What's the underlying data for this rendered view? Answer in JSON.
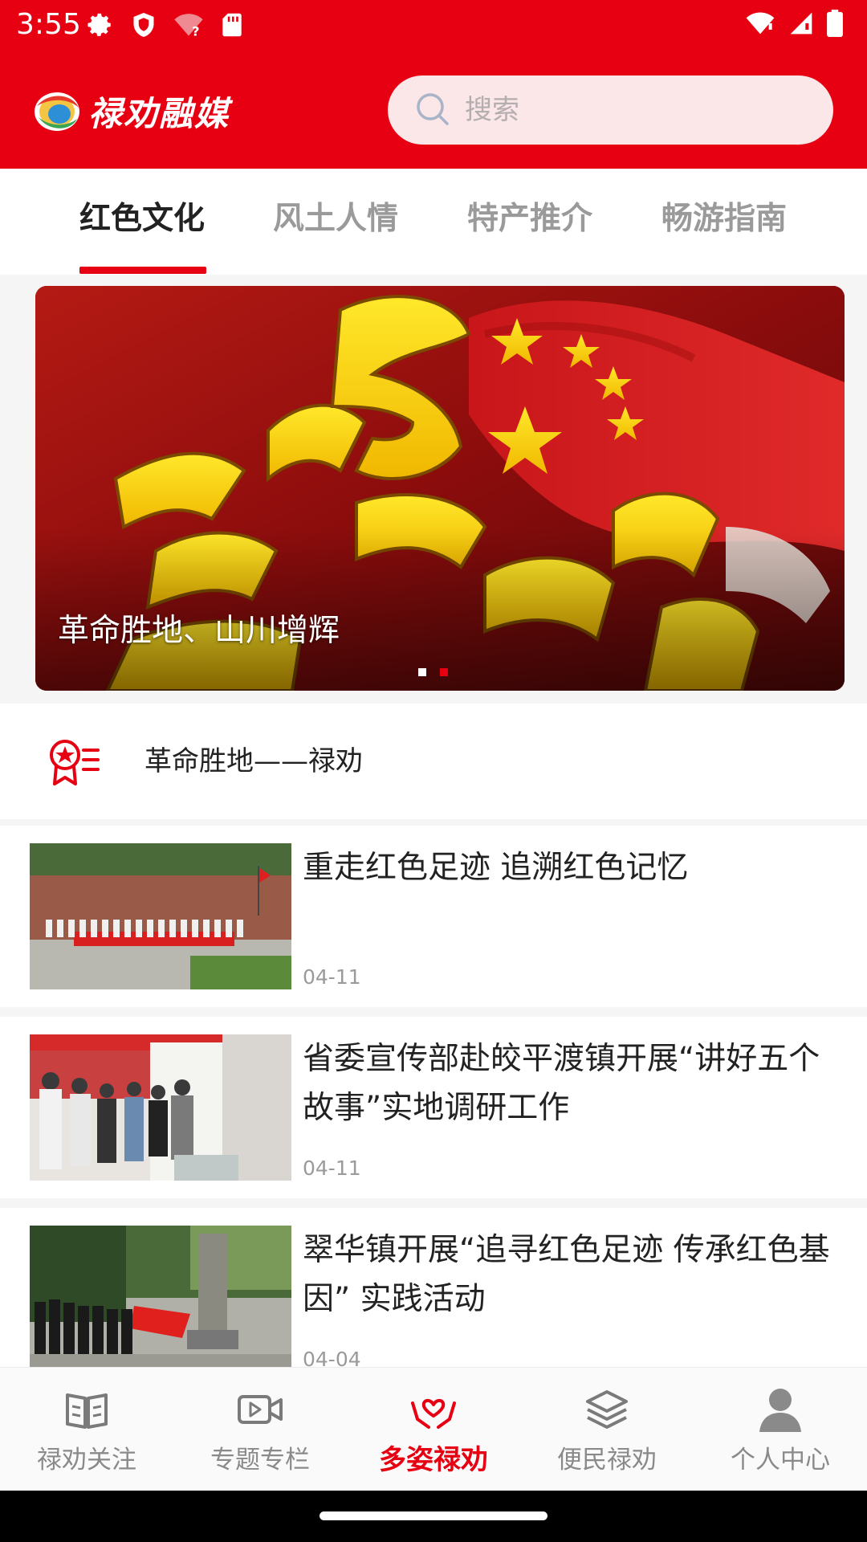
{
  "status_bar": {
    "time": "3:55",
    "left_icons": [
      "gear-icon",
      "shield-icon",
      "wifi-question-icon",
      "sd-card-icon"
    ],
    "right_icons": [
      "wifi-icon",
      "signal-icon",
      "battery-icon"
    ]
  },
  "header": {
    "logo_text": "禄劝融媒",
    "search_placeholder": "搜索"
  },
  "tabs": [
    {
      "label": "红色文化",
      "active": true
    },
    {
      "label": "风土人情",
      "active": false
    },
    {
      "label": "特产推介",
      "active": false
    },
    {
      "label": "畅游指南",
      "active": false
    }
  ],
  "banner": {
    "caption": "革命胜地、山川增辉",
    "dots": [
      "#ffffff",
      "#e60012"
    ]
  },
  "section": {
    "icon": "red-star-badge-icon",
    "label": "革命胜地——禄劝"
  },
  "news": [
    {
      "title": "重走红色足迹  追溯红色记忆",
      "date": "04-11"
    },
    {
      "title": "省委宣传部赴皎平渡镇开展“讲好五个故事”实地调研工作",
      "date": "04-11"
    },
    {
      "title": "翠华镇开展“追寻红色足迹 传承红色基因” 实践活动",
      "date": "04-04"
    }
  ],
  "bottom_nav": [
    {
      "label": "禄劝关注",
      "icon": "open-book-icon",
      "active": false
    },
    {
      "label": "专题专栏",
      "icon": "video-camera-icon",
      "active": false
    },
    {
      "label": "多姿禄劝",
      "icon": "heart-hands-icon",
      "active": true
    },
    {
      "label": "便民禄劝",
      "icon": "layers-icon",
      "active": false
    },
    {
      "label": "个人中心",
      "icon": "user-icon",
      "active": false
    }
  ],
  "colors": {
    "brand": "#e60012",
    "tab_inactive": "#9a9a9a",
    "text_primary": "#222222"
  }
}
